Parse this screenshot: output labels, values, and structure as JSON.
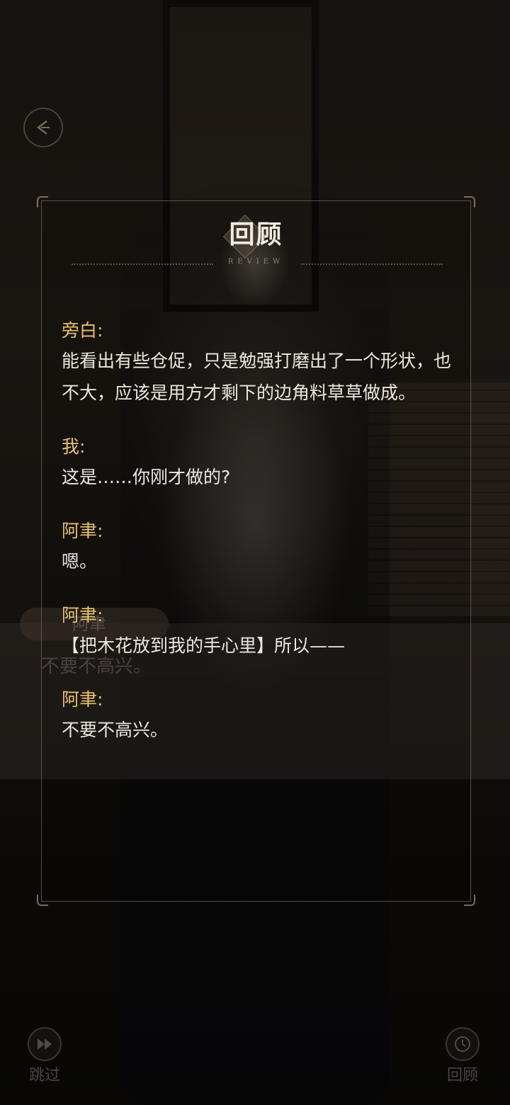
{
  "review": {
    "title": "回顾",
    "subtitle": "REVIEW",
    "entries": [
      {
        "speaker": "旁白:",
        "text": "能看出有些仓促，只是勉强打磨出了一个形状，也不大，应该是用方才剩下的边角料草草做成。"
      },
      {
        "speaker": "我:",
        "text": "这是……你刚才做的?"
      },
      {
        "speaker": "阿聿:",
        "text": "嗯。"
      },
      {
        "speaker": "阿聿:",
        "text": "【把木花放到我的手心里】所以——"
      },
      {
        "speaker": "阿聿:",
        "text": "不要不高兴。"
      }
    ]
  },
  "background_dialog": {
    "name": "阿聿",
    "text": "不要不高兴。"
  },
  "controls": {
    "back_icon": "back-arrow-icon",
    "skip_label": "跳过",
    "skip_icon": "fast-forward-icon",
    "review_label": "回顾",
    "review_icon": "clock-icon"
  },
  "colors": {
    "speaker": "#e8c270",
    "text": "#ece7df",
    "title": "#f1ebe0",
    "frame": "#968770"
  }
}
